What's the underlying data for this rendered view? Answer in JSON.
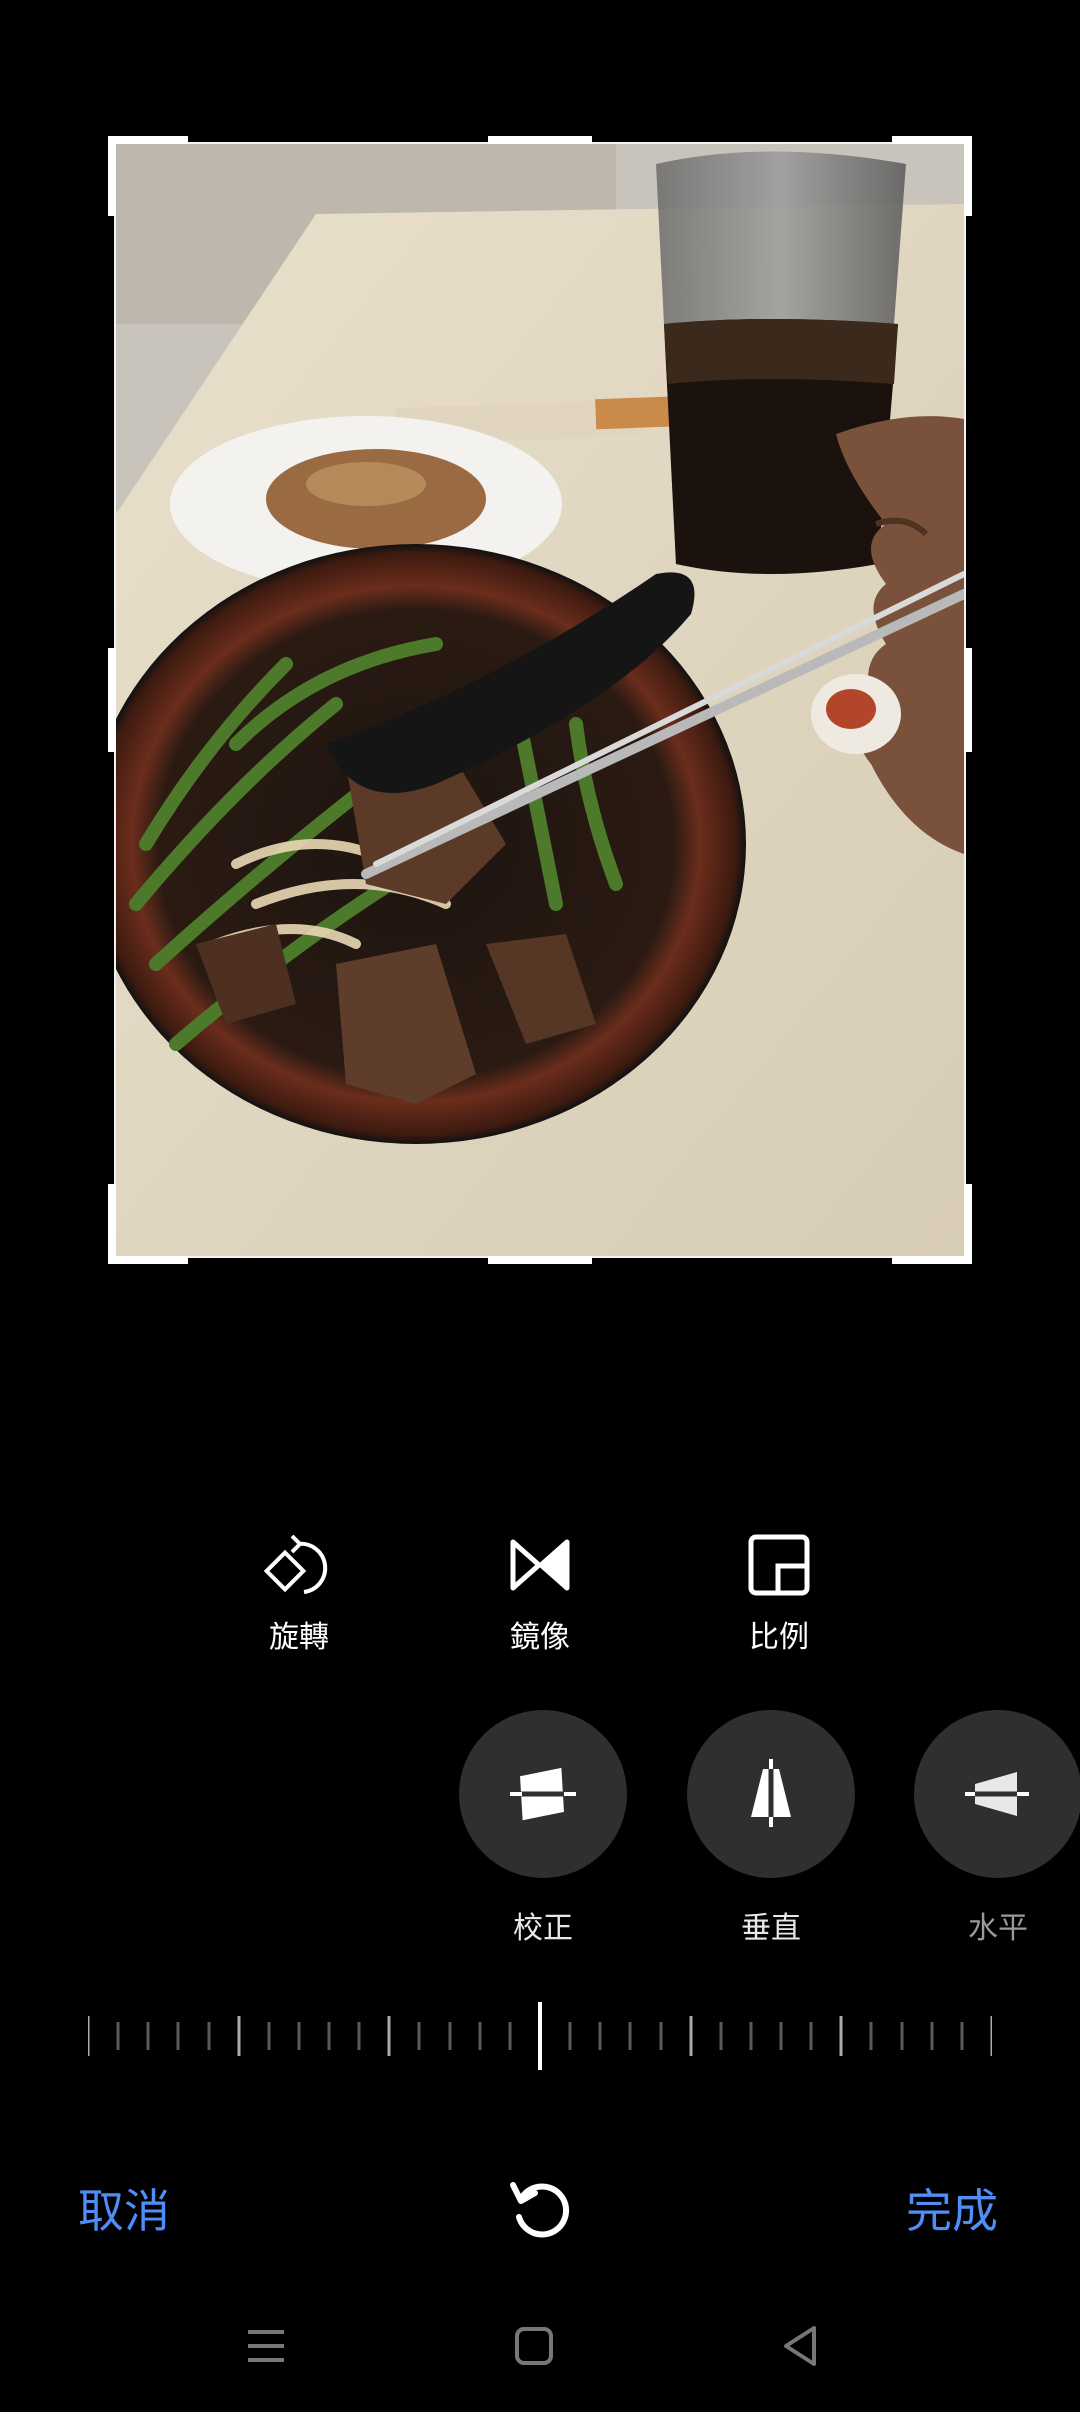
{
  "photo": {
    "description_icon": "photo-image"
  },
  "tools": [
    {
      "icon": "rotate-icon",
      "label": "旋轉"
    },
    {
      "icon": "mirror-icon",
      "label": "鏡像"
    },
    {
      "icon": "ratio-icon",
      "label": "比例"
    }
  ],
  "corrections": [
    {
      "icon": "straighten-icon",
      "label": "校正"
    },
    {
      "icon": "vertical-perspective-icon",
      "label": "垂直"
    },
    {
      "icon": "horizontal-perspective-icon",
      "label": "水平"
    }
  ],
  "ruler": {
    "value": 0
  },
  "actions": {
    "cancel_label": "取消",
    "done_label": "完成",
    "reset_icon": "reset-icon"
  },
  "colors": {
    "accent": "#4f8ef7",
    "background": "#000000",
    "button_bg": "#2f2f2f"
  },
  "navbar": {
    "icons": [
      "menu-icon",
      "home-icon",
      "back-icon"
    ]
  }
}
